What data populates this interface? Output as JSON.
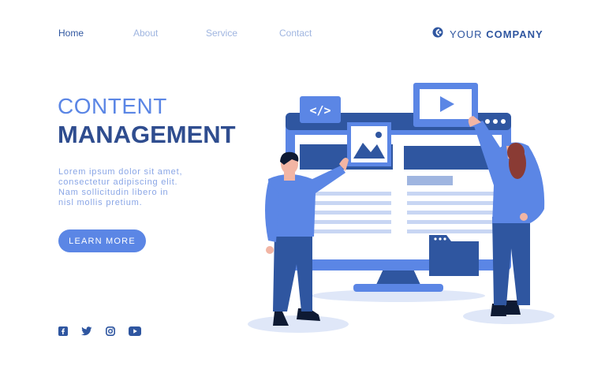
{
  "nav": {
    "items": [
      {
        "label": "Home"
      },
      {
        "label": "About"
      },
      {
        "label": "Service"
      },
      {
        "label": "Contact"
      }
    ]
  },
  "brand": {
    "word1": "YOUR",
    "word2": "COMPANY"
  },
  "hero": {
    "title_line1": "CONTENT",
    "title_line2": "MANAGEMENT",
    "body_lines": [
      "Lorem ipsum dolor sit amet,",
      "consectetur adipiscing elit.",
      "Nam sollicitudin libero in",
      "nisl mollis pretium."
    ],
    "cta_label": "LEARN MORE"
  },
  "social": [
    "facebook-icon",
    "twitter-icon",
    "instagram-icon",
    "youtube-icon"
  ],
  "illustration": {
    "code_badge": "</>"
  },
  "colors": {
    "primary": "#5b86e5",
    "dark": "#2f4d8f",
    "light": "#9fb5e0",
    "pale": "#dfe7f8"
  }
}
